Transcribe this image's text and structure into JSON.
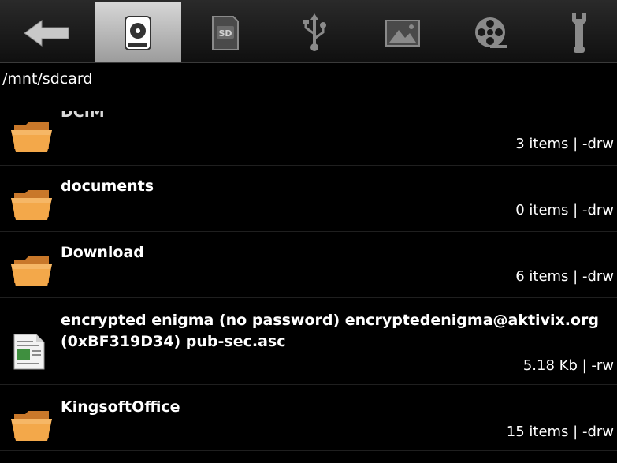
{
  "toolbar": {
    "buttons": [
      {
        "icon": "back-arrow-icon",
        "active": false
      },
      {
        "icon": "internal-storage-icon",
        "active": true
      },
      {
        "icon": "sd-card-icon",
        "label": "SD",
        "active": false
      },
      {
        "icon": "usb-icon",
        "active": false
      },
      {
        "icon": "pictures-icon",
        "active": false
      },
      {
        "icon": "video-reel-icon",
        "active": false
      },
      {
        "icon": "wrench-icon",
        "active": false
      }
    ]
  },
  "path": {
    "current": "/mnt/sdcard"
  },
  "files": [
    {
      "name": "DCIM",
      "type": "folder",
      "meta": "3 items | -drw"
    },
    {
      "name": "documents",
      "type": "folder",
      "meta": "0 items | -drw"
    },
    {
      "name": "Download",
      "type": "folder",
      "meta": "6 items | -drw"
    },
    {
      "name_line1": "encrypted enigma (no password) encryptedenigma@aktivix.org",
      "name_line2": "(0xBF319D34) pub-sec.asc",
      "type": "file",
      "meta": "5.18 Kb  | -rw"
    },
    {
      "name": "KingsoftOffice",
      "type": "folder",
      "meta": "15 items | -drw"
    }
  ],
  "colors": {
    "background": "#000000",
    "toolbar_active": "#bdbdbd",
    "folder": "#f0a040",
    "text": "#ffffff"
  }
}
